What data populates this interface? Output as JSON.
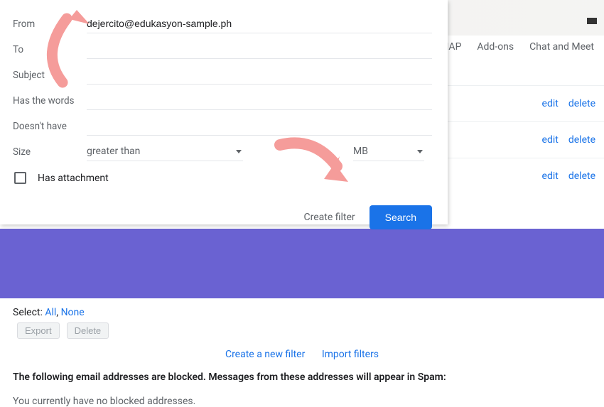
{
  "tabs": {
    "imap": "IMAP",
    "addons": "Add-ons",
    "chat": "Chat and Meet"
  },
  "filterRows": {
    "edit": "edit",
    "delete": "delete"
  },
  "popup": {
    "labels": {
      "from": "From",
      "to": "To",
      "subject": "Subject",
      "hasWords": "Has the words",
      "doesntHave": "Doesn't have",
      "size": "Size",
      "hasAttachment": "Has attachment"
    },
    "values": {
      "from": "dejercito@edukasyon-sample.ph",
      "sizeOp": "greater than",
      "sizeUnit": "MB"
    },
    "actions": {
      "createFilter": "Create filter",
      "search": "Search"
    }
  },
  "lower": {
    "selectLabel": "Select:",
    "all": "All",
    "none": "None",
    "comma": ",",
    "export": "Export",
    "delete": "Delete",
    "createNew": "Create a new filter",
    "import": "Import filters",
    "blockedMsg": "The following email addresses are blocked. Messages from these addresses will appear in Spam:",
    "noBlocked": "You currently have no blocked addresses."
  }
}
